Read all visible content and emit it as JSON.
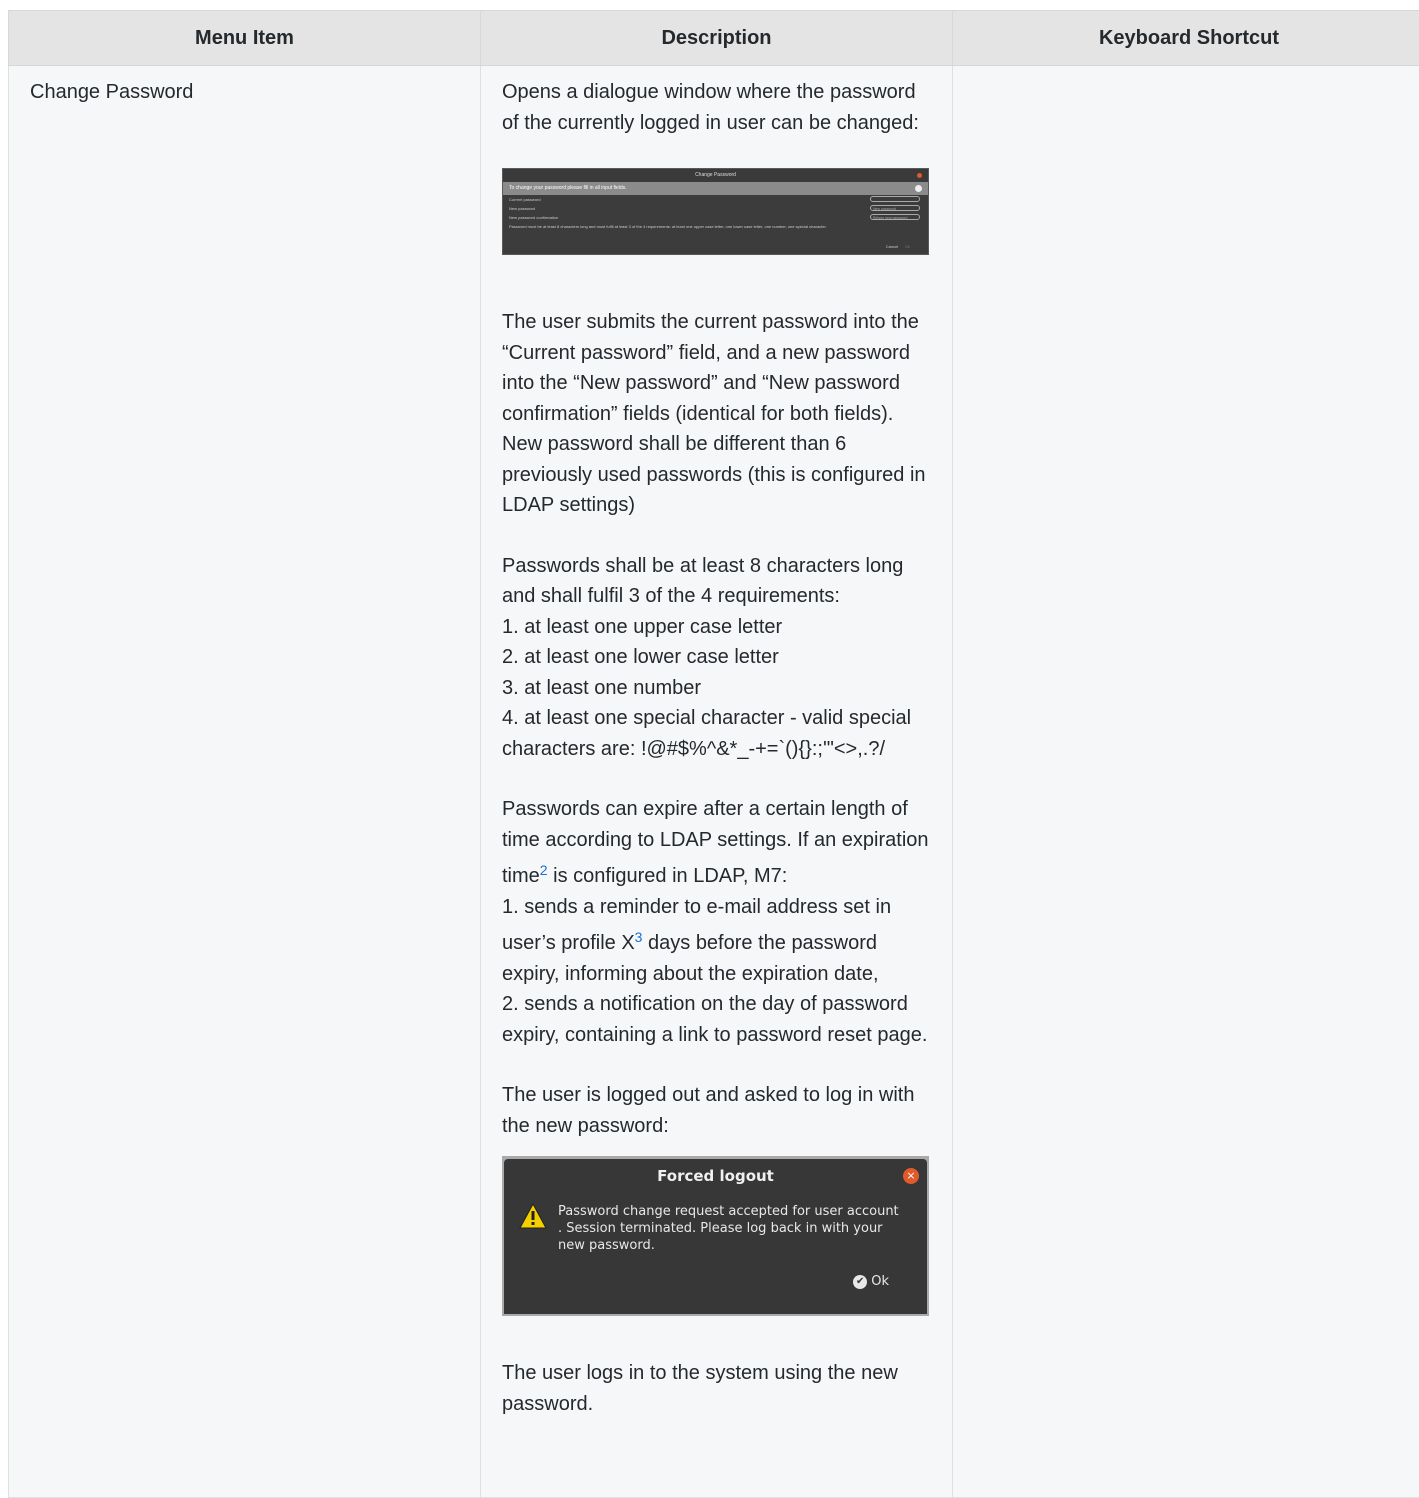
{
  "headers": [
    "Menu Item",
    "Description",
    "Keyboard Shortcut"
  ],
  "row": {
    "menu_item": "Change Password",
    "keyboard_shortcut": "",
    "intro": "Opens a dialogue window where the password of the currently logged in user can be changed:",
    "para_submit": "The user submits the current password into the “Current password” field, and a new password into the “New password” and “New password confirmation” fields (identical for both fields). New password shall be different than 6 previously used passwords (this is configured in LDAP settings)",
    "req_intro": "Passwords shall be at least 8 characters long and shall fulfil 3 of the 4 requirements:",
    "req_1": "1. at least one upper case letter",
    "req_2": "2. at least one lower case letter",
    "req_3": "3. at least one number",
    "req_4": "4. at least one special character - valid special characters are: !@#$%^&*_-+=`(){}:;'\"<>,.?/",
    "expire_a": "Passwords can expire after a certain length of time according to LDAP settings. If an expiration time",
    "expire_sup": "2",
    "expire_b": " is configured in LDAP, M7:",
    "expire_1a": "1. sends a reminder to e-mail address set in user’s profile X",
    "expire_1sup": "3",
    "expire_1b": " days before the password expiry, informing about the expiration date,",
    "expire_2": "2. sends a notification on the day of password expiry, containing a link to password reset page.",
    "logout_intro": "The user is logged out and asked to log in with the new password:",
    "final": "The user logs in to the system using the new password."
  },
  "change_dialog": {
    "title": "Change Password",
    "info": "To change your password please fill in all input fields.",
    "current": "Current password",
    "new": "New password",
    "confirm": "New password confirmation",
    "new_placeholder": "New password",
    "confirm_placeholder": "Retype new password",
    "rule": "Password must be at least 8 characters long and must fulfil at least 3 of the 4 requirements: at least one upper case letter, one lower case letter, one number, one special character.",
    "cancel": "Cancel",
    "ok": "Ok"
  },
  "logout_dialog": {
    "title": "Forced logout",
    "message": "Password change request accepted for user account . Session terminated. Please log back in with your new password.",
    "ok": "Ok",
    "close_glyph": "×",
    "check_glyph": "✔"
  },
  "colors": {
    "header_bg": "#e4e4e4",
    "cell_bg": "#f6f7f9",
    "link": "#1a6fd4",
    "dialog_bg": "#373737",
    "warning": "#f5d000"
  }
}
